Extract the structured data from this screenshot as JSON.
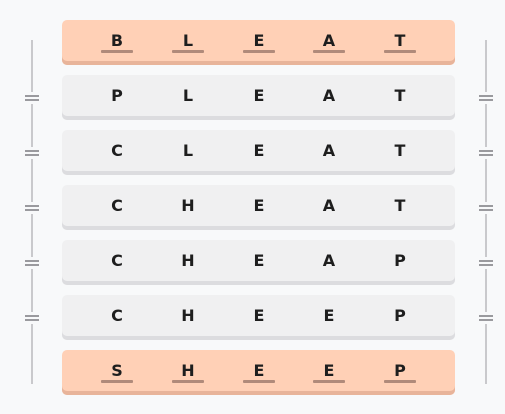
{
  "ladder": {
    "start_word": "BLEAT",
    "end_word": "SHEEP",
    "rows": [
      {
        "letters": [
          "B",
          "L",
          "E",
          "A",
          "T"
        ],
        "kind": "end"
      },
      {
        "letters": [
          "P",
          "L",
          "E",
          "A",
          "T"
        ],
        "kind": "step"
      },
      {
        "letters": [
          "C",
          "L",
          "E",
          "A",
          "T"
        ],
        "kind": "step"
      },
      {
        "letters": [
          "C",
          "H",
          "E",
          "A",
          "T"
        ],
        "kind": "step"
      },
      {
        "letters": [
          "C",
          "H",
          "E",
          "A",
          "P"
        ],
        "kind": "step"
      },
      {
        "letters": [
          "C",
          "H",
          "E",
          "E",
          "P"
        ],
        "kind": "step"
      },
      {
        "letters": [
          "S",
          "H",
          "E",
          "E",
          "P"
        ],
        "kind": "end"
      }
    ],
    "connector_icon": "equals-icon"
  },
  "colors": {
    "end_row": "#ffd0b6",
    "step_row": "#f0f0f1",
    "underline": "#b08a7a",
    "rail": "#c9c9cc"
  }
}
